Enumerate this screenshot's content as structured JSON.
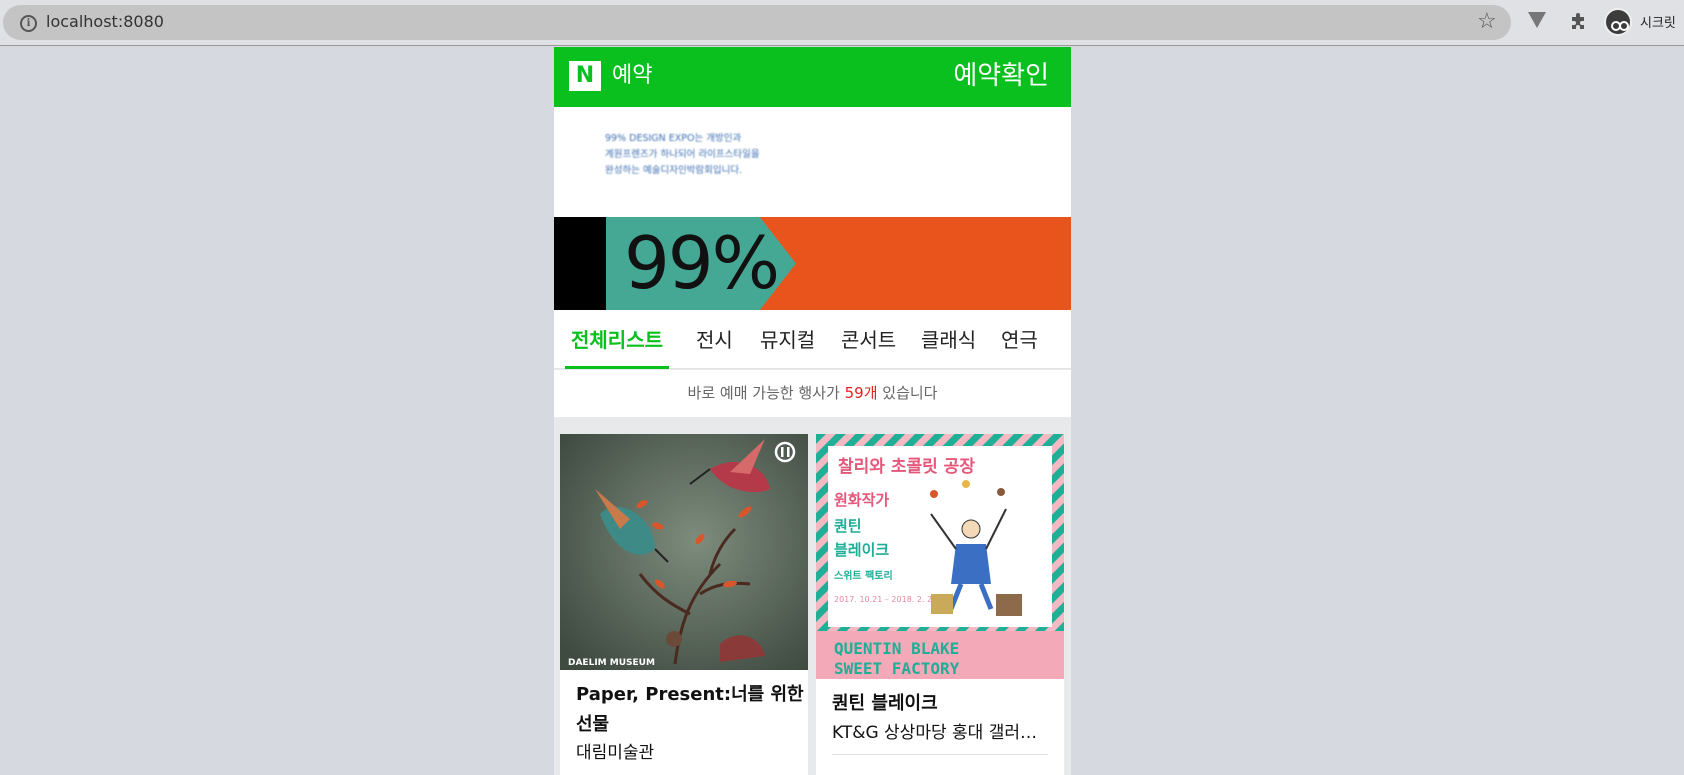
{
  "browser": {
    "url": "localhost:8080",
    "profile_label": "시크릿"
  },
  "header": {
    "logo_letter": "N",
    "logo_text": "예약",
    "confirm_label": "예약확인"
  },
  "banner": {
    "text_lines": [
      "99% DESIGN EXPO는 개방인과",
      "계원프렌즈가 하나되어 라이프스타일을",
      "완성하는 예술디자인박람회입니다."
    ],
    "big_text": "99%",
    "colors": {
      "black": "#000000",
      "teal": "#45a895",
      "orange": "#e9541d"
    }
  },
  "tabs": [
    "전체리스트",
    "전시",
    "뮤지컬",
    "콘서트",
    "클래식",
    "연극"
  ],
  "active_tab": 0,
  "count_bar": {
    "prefix": "바로 예매 가능한 행사가 ",
    "count": "59개",
    "suffix": " 있습니다"
  },
  "cards": [
    {
      "title_line1": "Paper, Present:너를 위한",
      "title_line2": "선물",
      "place": "대림미술관",
      "image_caption": "DAELIM MUSEUM"
    },
    {
      "title": "퀀틴 블레이크",
      "place": "KT&G 상상마당 홍대 갤러…",
      "poster": {
        "headline": "찰리와 초콜릿 공장",
        "line1": "원화작가",
        "line2": "퀀틴",
        "line3": "블레이크",
        "line4": "스위트 팩토리",
        "dates": "2017. 10.21 –\n2018. 2. 20",
        "footer1": "QUENTIN BLAKE",
        "footer2": "SWEET FACTORY"
      }
    }
  ],
  "colors": {
    "brand_green": "#0ac01e",
    "count_red": "#e0231f",
    "page_bg": "#d6d9df"
  }
}
